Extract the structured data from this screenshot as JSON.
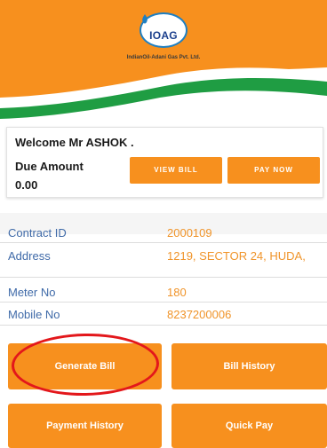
{
  "header": {
    "logo_text": "IOAG",
    "company_name": "IndianOil-Adani Gas Pvt. Ltd."
  },
  "welcome": {
    "greeting": "Welcome Mr ASHOK .",
    "due_label": "Due Amount",
    "due_value": "0.00",
    "view_bill_label": "VIEW BILL",
    "pay_now_label": "PAY NOW"
  },
  "info": [
    {
      "label": "Contract ID",
      "value": "2000109"
    },
    {
      "label": "Address",
      "value": "1219, SECTOR 24, HUDA,"
    },
    {
      "label": "Meter No",
      "value": "180"
    },
    {
      "label": "Mobile No",
      "value": "8237200006"
    }
  ],
  "actions": {
    "generate_bill": "Generate Bill",
    "bill_history": "Bill History",
    "payment_history": "Payment History",
    "quick_pay": "Quick Pay"
  },
  "colors": {
    "primary_orange": "#f7901e",
    "green": "#1f9d43",
    "label_blue": "#3f6aa8",
    "value_orange": "#f0942a",
    "highlight_red": "#e3171b"
  }
}
